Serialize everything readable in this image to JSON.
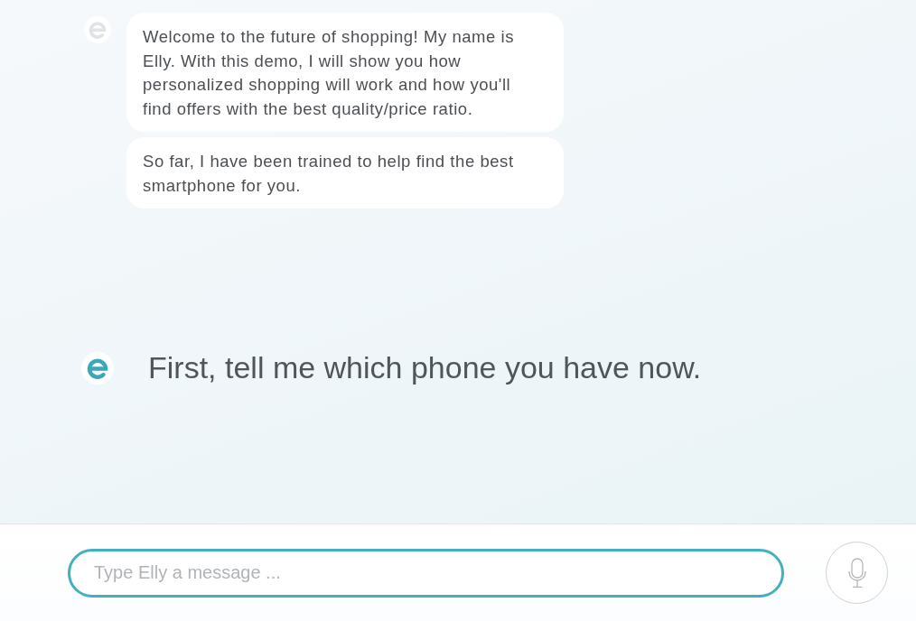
{
  "messages": [
    {
      "kind": "bubbles",
      "active": false,
      "bubbles": [
        "Welcome to the future of shopping! My name is Elly. With this demo, I will show you how personalized shopping will work and how you'll find offers with the best quality/price ratio.",
        "So far, I have been trained to help find the best smartphone for you."
      ]
    },
    {
      "kind": "prompt",
      "active": true,
      "text": "First, tell me which phone you have now."
    }
  ],
  "composer": {
    "placeholder": "Type Elly a message ..."
  }
}
